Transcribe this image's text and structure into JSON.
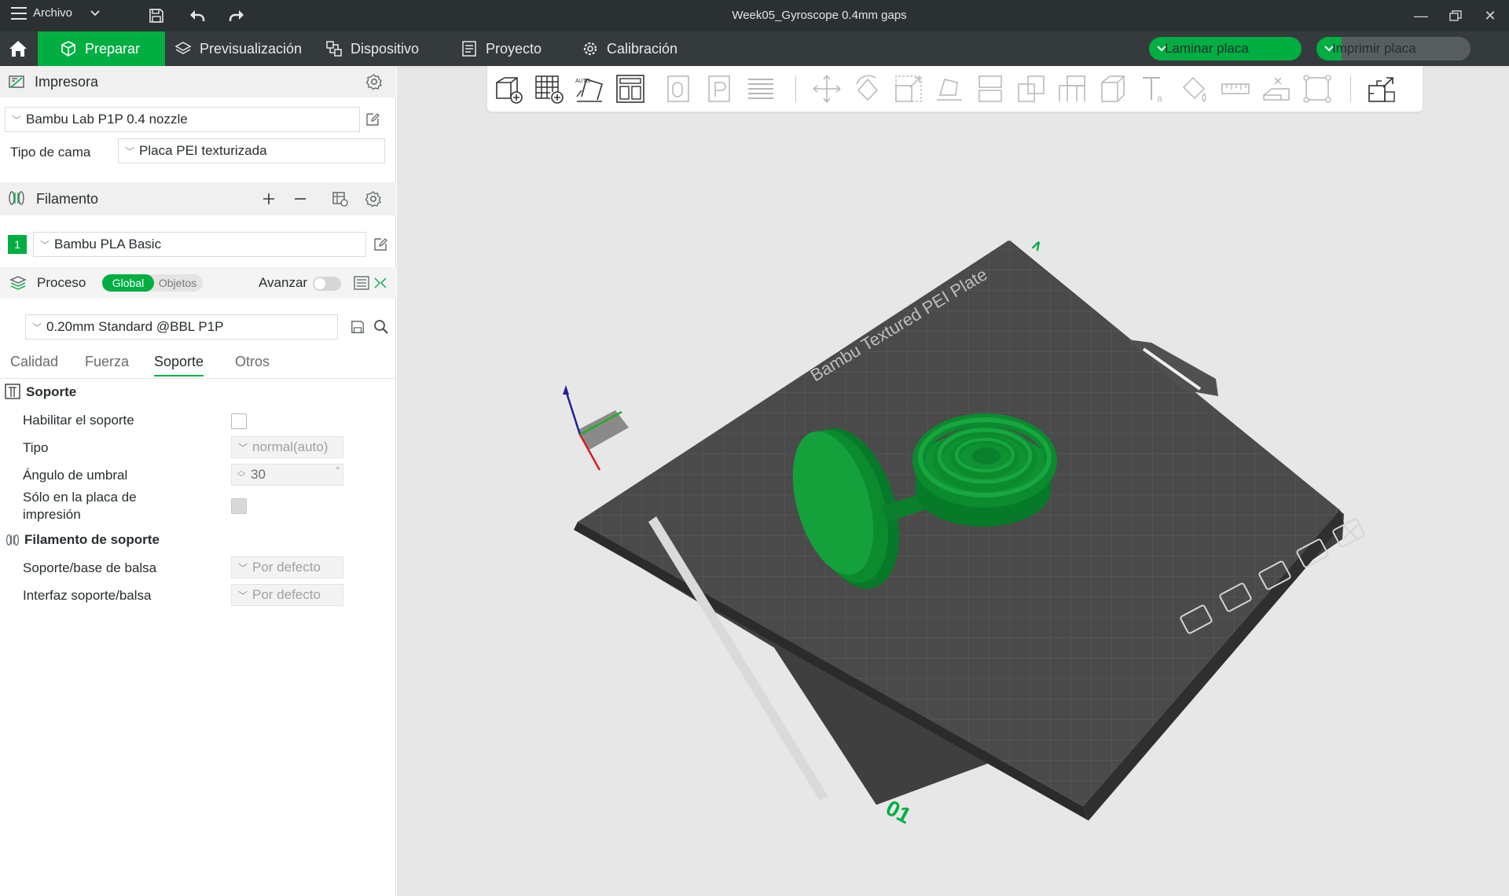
{
  "titlebar": {
    "menu_label": "Archivo",
    "title": "Week05_Gyroscope 0.4mm gaps"
  },
  "tabs": [
    {
      "label": "Preparar",
      "icon": "cube-icon",
      "active": true
    },
    {
      "label": "Previsualización",
      "icon": "layers-icon"
    },
    {
      "label": "Dispositivo",
      "icon": "device-icon"
    },
    {
      "label": "Proyecto",
      "icon": "project-icon"
    },
    {
      "label": "Calibración",
      "icon": "calibration-icon"
    }
  ],
  "actions": {
    "slice_label": "Laminar placa",
    "print_label": "Imprimir placa"
  },
  "printer": {
    "header": "Impresora",
    "selected": "Bambu Lab P1P 0.4 nozzle",
    "bed_type_label": "Tipo de cama",
    "bed_type_value": "Placa PEI texturizada"
  },
  "filament": {
    "header": "Filamento",
    "slots": [
      {
        "index": "1",
        "name": "Bambu PLA Basic",
        "color": "#00ae42"
      }
    ]
  },
  "process": {
    "header": "Proceso",
    "toggle_global": "Global",
    "toggle_objects": "Objetos",
    "advanced_label": "Avanzar",
    "preset": "0.20mm Standard @BBL P1P",
    "subtabs": [
      "Calidad",
      "Fuerza",
      "Soporte",
      "Otros"
    ],
    "active_subtab": "Soporte"
  },
  "support": {
    "group_title": "Soporte",
    "enable_label": "Habilitar el soporte",
    "type_label": "Tipo",
    "type_value": "normal(auto)",
    "threshold_label": "Ángulo de umbral",
    "threshold_value": "30",
    "threshold_unit": "°",
    "only_plate_label_1": "Sólo en la placa de",
    "only_plate_label_2": "impresión"
  },
  "support_filament": {
    "group_title": "Filamento de soporte",
    "base_label": "Soporte/base de balsa",
    "base_value": "Por defecto",
    "interface_label": "Interfaz soporte/balsa",
    "interface_value": "Por defecto"
  },
  "plate": {
    "brand_text": "Bambu Textured PEI Plate",
    "plate_number": "01",
    "model_color": "#0b8a2e"
  }
}
